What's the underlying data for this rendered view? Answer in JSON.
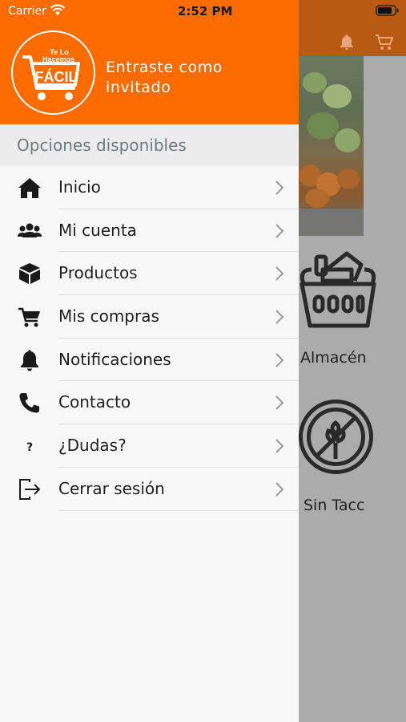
{
  "status_bar": {
    "carrier": "Carrier",
    "time": "2:52 PM"
  },
  "drawer": {
    "header_bg": "#fd6c00",
    "logo": {
      "line1": "Te Lo",
      "line2": "Hacemos",
      "line3": "FÁCIL"
    },
    "guest_message": "Entraste como invitado",
    "section_title": "Opciones disponibles",
    "items": [
      {
        "label": "Inicio",
        "icon": "home-icon"
      },
      {
        "label": "Mi cuenta",
        "icon": "users-icon"
      },
      {
        "label": "Productos",
        "icon": "box-icon"
      },
      {
        "label": "Mis compras",
        "icon": "cart-icon"
      },
      {
        "label": "Notificaciones",
        "icon": "bell-icon"
      },
      {
        "label": "Contacto",
        "icon": "phone-icon"
      },
      {
        "label": "¿Dudas?",
        "icon": "question-icon"
      },
      {
        "label": "Cerrar sesión",
        "icon": "logout-icon"
      }
    ]
  },
  "background": {
    "categories": [
      {
        "label": "Almacén",
        "icon": "grocery-basket-icon"
      },
      {
        "label": "Sin Tacc",
        "icon": "gluten-free-icon"
      }
    ]
  }
}
